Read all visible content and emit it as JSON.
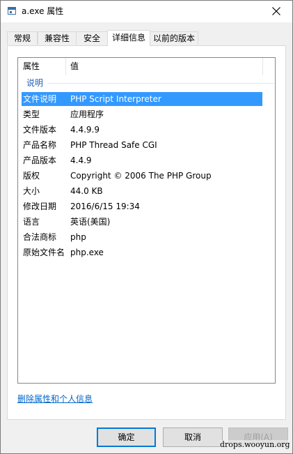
{
  "window": {
    "title": "a.exe 属性"
  },
  "tabs": [
    {
      "label": "常规"
    },
    {
      "label": "兼容性"
    },
    {
      "label": "安全"
    },
    {
      "label": "详细信息"
    },
    {
      "label": "以前的版本"
    }
  ],
  "active_tab": "详细信息",
  "details": {
    "columns": {
      "property": "属性",
      "value": "值"
    },
    "group_label": "说明",
    "rows": [
      {
        "key": "文件说明",
        "value": "PHP Script Interpreter"
      },
      {
        "key": "类型",
        "value": "应用程序"
      },
      {
        "key": "文件版本",
        "value": "4.4.9.9"
      },
      {
        "key": "产品名称",
        "value": "PHP Thread Safe CGI"
      },
      {
        "key": "产品版本",
        "value": "4.4.9"
      },
      {
        "key": "版权",
        "value": "Copyright © 2006 The PHP Group"
      },
      {
        "key": "大小",
        "value": "44.0 KB"
      },
      {
        "key": "修改日期",
        "value": "2016/6/15 19:34"
      },
      {
        "key": "语言",
        "value": "英语(美国)"
      },
      {
        "key": "合法商标",
        "value": "php"
      },
      {
        "key": "原始文件名",
        "value": "php.exe"
      }
    ],
    "selected_row": "文件说明"
  },
  "remove_properties_link": "删除属性和个人信息",
  "buttons": {
    "ok": "确定",
    "cancel": "取消",
    "apply": "应用(A)"
  },
  "watermark": "drops.wooyun.org",
  "colors": {
    "selection": "#3399ff",
    "link": "#0066cc",
    "default_button_border": "#0078d7"
  },
  "icons": {
    "app": "application-window-icon",
    "close": "close-icon"
  }
}
